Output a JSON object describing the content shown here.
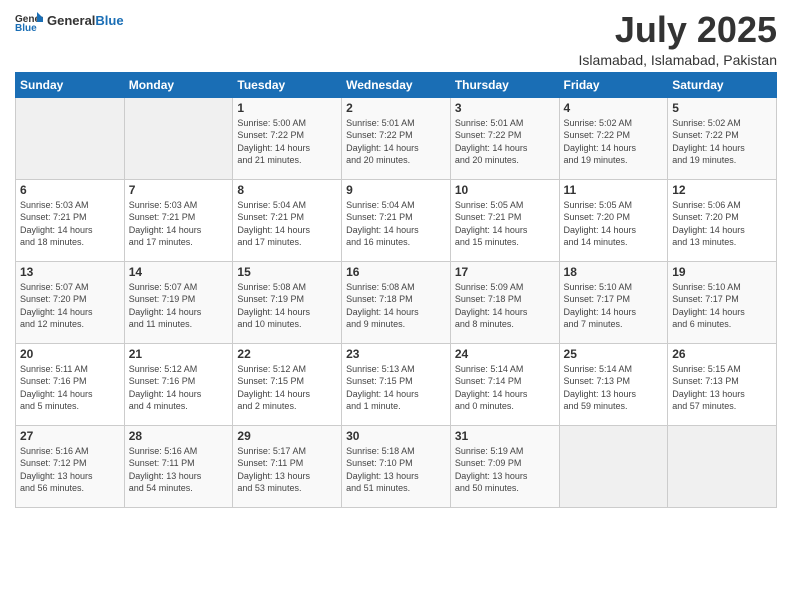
{
  "logo": {
    "general": "General",
    "blue": "Blue"
  },
  "header": {
    "month_year": "July 2025",
    "location": "Islamabad, Islamabad, Pakistan"
  },
  "weekdays": [
    "Sunday",
    "Monday",
    "Tuesday",
    "Wednesday",
    "Thursday",
    "Friday",
    "Saturday"
  ],
  "weeks": [
    [
      {
        "day": "",
        "info": ""
      },
      {
        "day": "",
        "info": ""
      },
      {
        "day": "1",
        "info": "Sunrise: 5:00 AM\nSunset: 7:22 PM\nDaylight: 14 hours\nand 21 minutes."
      },
      {
        "day": "2",
        "info": "Sunrise: 5:01 AM\nSunset: 7:22 PM\nDaylight: 14 hours\nand 20 minutes."
      },
      {
        "day": "3",
        "info": "Sunrise: 5:01 AM\nSunset: 7:22 PM\nDaylight: 14 hours\nand 20 minutes."
      },
      {
        "day": "4",
        "info": "Sunrise: 5:02 AM\nSunset: 7:22 PM\nDaylight: 14 hours\nand 19 minutes."
      },
      {
        "day": "5",
        "info": "Sunrise: 5:02 AM\nSunset: 7:22 PM\nDaylight: 14 hours\nand 19 minutes."
      }
    ],
    [
      {
        "day": "6",
        "info": "Sunrise: 5:03 AM\nSunset: 7:21 PM\nDaylight: 14 hours\nand 18 minutes."
      },
      {
        "day": "7",
        "info": "Sunrise: 5:03 AM\nSunset: 7:21 PM\nDaylight: 14 hours\nand 17 minutes."
      },
      {
        "day": "8",
        "info": "Sunrise: 5:04 AM\nSunset: 7:21 PM\nDaylight: 14 hours\nand 17 minutes."
      },
      {
        "day": "9",
        "info": "Sunrise: 5:04 AM\nSunset: 7:21 PM\nDaylight: 14 hours\nand 16 minutes."
      },
      {
        "day": "10",
        "info": "Sunrise: 5:05 AM\nSunset: 7:21 PM\nDaylight: 14 hours\nand 15 minutes."
      },
      {
        "day": "11",
        "info": "Sunrise: 5:05 AM\nSunset: 7:20 PM\nDaylight: 14 hours\nand 14 minutes."
      },
      {
        "day": "12",
        "info": "Sunrise: 5:06 AM\nSunset: 7:20 PM\nDaylight: 14 hours\nand 13 minutes."
      }
    ],
    [
      {
        "day": "13",
        "info": "Sunrise: 5:07 AM\nSunset: 7:20 PM\nDaylight: 14 hours\nand 12 minutes."
      },
      {
        "day": "14",
        "info": "Sunrise: 5:07 AM\nSunset: 7:19 PM\nDaylight: 14 hours\nand 11 minutes."
      },
      {
        "day": "15",
        "info": "Sunrise: 5:08 AM\nSunset: 7:19 PM\nDaylight: 14 hours\nand 10 minutes."
      },
      {
        "day": "16",
        "info": "Sunrise: 5:08 AM\nSunset: 7:18 PM\nDaylight: 14 hours\nand 9 minutes."
      },
      {
        "day": "17",
        "info": "Sunrise: 5:09 AM\nSunset: 7:18 PM\nDaylight: 14 hours\nand 8 minutes."
      },
      {
        "day": "18",
        "info": "Sunrise: 5:10 AM\nSunset: 7:17 PM\nDaylight: 14 hours\nand 7 minutes."
      },
      {
        "day": "19",
        "info": "Sunrise: 5:10 AM\nSunset: 7:17 PM\nDaylight: 14 hours\nand 6 minutes."
      }
    ],
    [
      {
        "day": "20",
        "info": "Sunrise: 5:11 AM\nSunset: 7:16 PM\nDaylight: 14 hours\nand 5 minutes."
      },
      {
        "day": "21",
        "info": "Sunrise: 5:12 AM\nSunset: 7:16 PM\nDaylight: 14 hours\nand 4 minutes."
      },
      {
        "day": "22",
        "info": "Sunrise: 5:12 AM\nSunset: 7:15 PM\nDaylight: 14 hours\nand 2 minutes."
      },
      {
        "day": "23",
        "info": "Sunrise: 5:13 AM\nSunset: 7:15 PM\nDaylight: 14 hours\nand 1 minute."
      },
      {
        "day": "24",
        "info": "Sunrise: 5:14 AM\nSunset: 7:14 PM\nDaylight: 14 hours\nand 0 minutes."
      },
      {
        "day": "25",
        "info": "Sunrise: 5:14 AM\nSunset: 7:13 PM\nDaylight: 13 hours\nand 59 minutes."
      },
      {
        "day": "26",
        "info": "Sunrise: 5:15 AM\nSunset: 7:13 PM\nDaylight: 13 hours\nand 57 minutes."
      }
    ],
    [
      {
        "day": "27",
        "info": "Sunrise: 5:16 AM\nSunset: 7:12 PM\nDaylight: 13 hours\nand 56 minutes."
      },
      {
        "day": "28",
        "info": "Sunrise: 5:16 AM\nSunset: 7:11 PM\nDaylight: 13 hours\nand 54 minutes."
      },
      {
        "day": "29",
        "info": "Sunrise: 5:17 AM\nSunset: 7:11 PM\nDaylight: 13 hours\nand 53 minutes."
      },
      {
        "day": "30",
        "info": "Sunrise: 5:18 AM\nSunset: 7:10 PM\nDaylight: 13 hours\nand 51 minutes."
      },
      {
        "day": "31",
        "info": "Sunrise: 5:19 AM\nSunset: 7:09 PM\nDaylight: 13 hours\nand 50 minutes."
      },
      {
        "day": "",
        "info": ""
      },
      {
        "day": "",
        "info": ""
      }
    ]
  ]
}
